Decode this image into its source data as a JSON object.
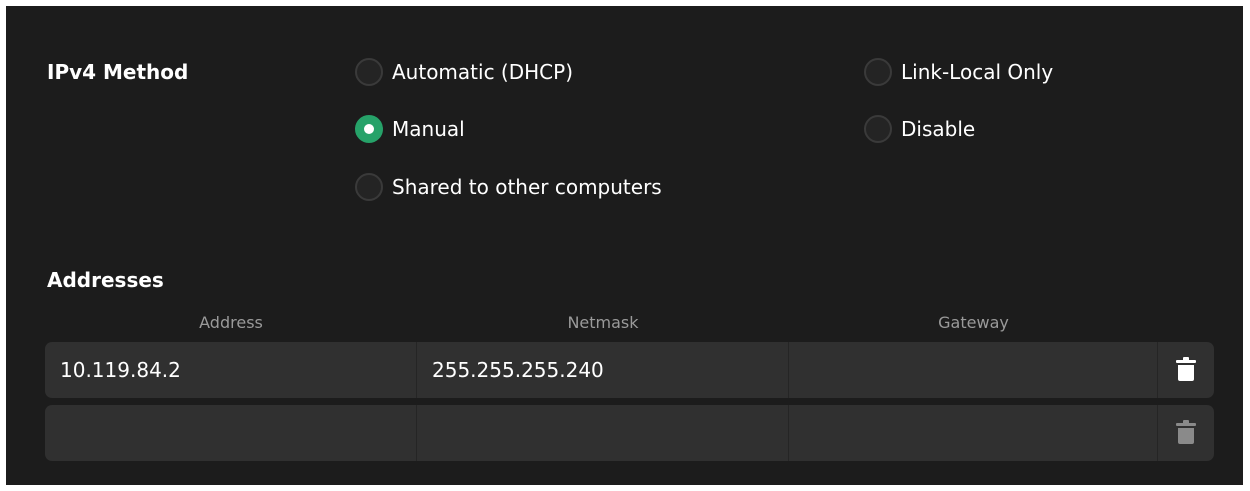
{
  "ipv4_method": {
    "label": "IPv4 Method",
    "options": [
      {
        "label": "Automatic (DHCP)",
        "checked": false
      },
      {
        "label": "Link-Local Only",
        "checked": false
      },
      {
        "label": "Manual",
        "checked": true
      },
      {
        "label": "Disable",
        "checked": false
      },
      {
        "label": "Shared to other computers",
        "checked": false
      }
    ]
  },
  "addresses": {
    "label": "Addresses",
    "columns": [
      "Address",
      "Netmask",
      "Gateway"
    ],
    "rows": [
      {
        "address": "10.119.84.2",
        "netmask": "255.255.255.240",
        "gateway": ""
      },
      {
        "address": "",
        "netmask": "",
        "gateway": ""
      }
    ],
    "delete_icon": "trash-icon"
  },
  "colors": {
    "background": "#1c1c1c",
    "row_background": "#303030",
    "accent": "#26a269",
    "text": "#ffffff",
    "muted_text": "#9a9a9a"
  }
}
